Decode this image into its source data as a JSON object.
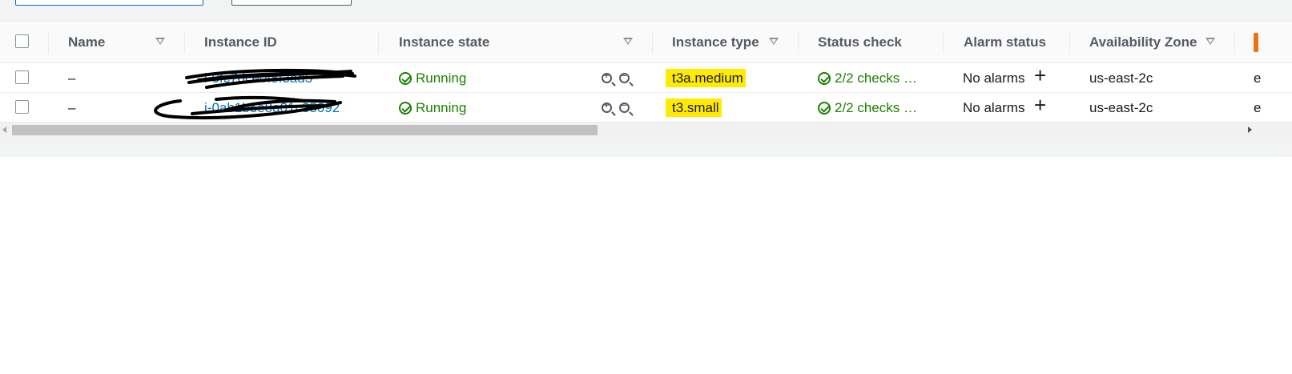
{
  "table": {
    "columns": {
      "name": "Name",
      "instance_id": "Instance ID",
      "instance_state": "Instance state",
      "instance_type": "Instance type",
      "status_check": "Status check",
      "alarm_status": "Alarm status",
      "availability_zone": "Availability Zone"
    },
    "rows": [
      {
        "name": "–",
        "instance_id": "i-0fc7dce0f8f3ad5",
        "state": "Running",
        "type": "t3a.medium",
        "status_check": "2/2 checks …",
        "alarm": "No alarms",
        "zone": "us-east-2c",
        "edge": "e"
      },
      {
        "name": "–",
        "instance_id": "i-0ab1b5e8a01c35092",
        "state": "Running",
        "type": "t3.small",
        "status_check": "2/2 checks …",
        "alarm": "No alarms",
        "zone": "us-east-2c",
        "edge": "e"
      }
    ]
  },
  "icons": {
    "state": "check-circle-icon",
    "zoom_in": "zoom-in-icon",
    "zoom_out": "zoom-out-icon",
    "add_alarm": "plus-icon",
    "sort": "sort-down-icon"
  },
  "colors": {
    "link": "#0073bb",
    "success": "#1d8102",
    "highlight": "#ffeb00"
  }
}
